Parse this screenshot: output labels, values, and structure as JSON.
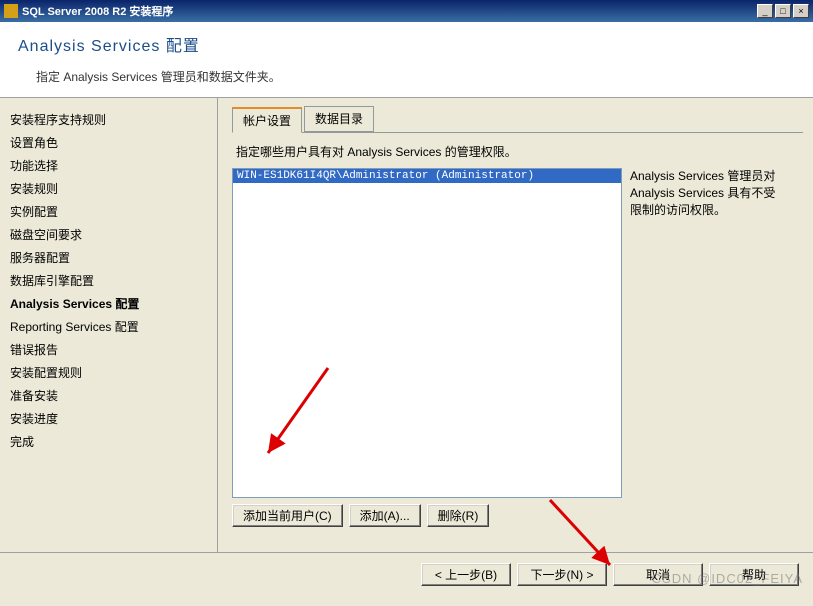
{
  "window": {
    "title": "SQL Server 2008 R2 安装程序"
  },
  "header": {
    "title": "Analysis Services 配置",
    "subtitle": "指定 Analysis Services 管理员和数据文件夹。"
  },
  "sidebar": {
    "items": [
      {
        "label": "安装程序支持规则",
        "active": false
      },
      {
        "label": "设置角色",
        "active": false
      },
      {
        "label": "功能选择",
        "active": false
      },
      {
        "label": "安装规则",
        "active": false
      },
      {
        "label": "实例配置",
        "active": false
      },
      {
        "label": "磁盘空间要求",
        "active": false
      },
      {
        "label": "服务器配置",
        "active": false
      },
      {
        "label": "数据库引擎配置",
        "active": false
      },
      {
        "label": "Analysis Services 配置",
        "active": true
      },
      {
        "label": "Reporting Services 配置",
        "active": false
      },
      {
        "label": "错误报告",
        "active": false
      },
      {
        "label": "安装配置规则",
        "active": false
      },
      {
        "label": "准备安装",
        "active": false
      },
      {
        "label": "安装进度",
        "active": false
      },
      {
        "label": "完成",
        "active": false
      }
    ]
  },
  "tabs": [
    {
      "label": "帐户设置",
      "active": true
    },
    {
      "label": "数据目录",
      "active": false
    }
  ],
  "tab_content": {
    "description": "指定哪些用户具有对 Analysis Services 的管理权限。",
    "admins": [
      "WIN-ES1DK61I4QR\\Administrator (Administrator)"
    ],
    "hint": "Analysis Services 管理员对 Analysis Services 具有不受限制的访问权限。",
    "buttons": {
      "add_current": "添加当前用户(C)",
      "add": "添加(A)...",
      "remove": "删除(R)"
    }
  },
  "footer": {
    "back": "< 上一步(B)",
    "next": "下一步(N) >",
    "cancel": "取消",
    "help": "帮助"
  },
  "watermark": "CSDN @IDC02_FEIYA"
}
